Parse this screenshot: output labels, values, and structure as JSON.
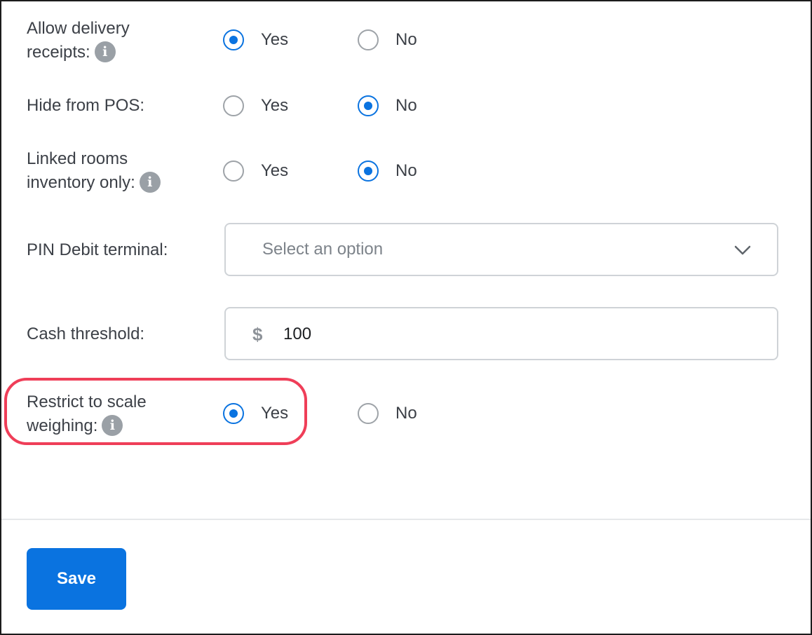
{
  "settings": {
    "delivery_receipts": {
      "label_line1": "Allow delivery",
      "label_line2": "receipts:",
      "info_icon": "i",
      "yes_label": "Yes",
      "no_label": "No",
      "selected": "Yes"
    },
    "hide_from_pos": {
      "label": "Hide from POS:",
      "yes_label": "Yes",
      "no_label": "No",
      "selected": "No"
    },
    "linked_rooms": {
      "label_line1": "Linked rooms",
      "label_line2": "inventory only:",
      "info_icon": "i",
      "yes_label": "Yes",
      "no_label": "No",
      "selected": "No"
    },
    "pin_debit": {
      "label": "PIN Debit terminal:",
      "placeholder": "Select an option"
    },
    "cash_threshold": {
      "label": "Cash threshold:",
      "currency_symbol": "$",
      "value": "100"
    },
    "scale_weighing": {
      "label_line1": "Restrict to scale",
      "label_line2": "weighing:",
      "info_icon": "i",
      "yes_label": "Yes",
      "no_label": "No",
      "selected": "Yes"
    }
  },
  "footer": {
    "save_label": "Save"
  },
  "colors": {
    "accent": "#0a73e0",
    "highlight": "#ef3e58"
  }
}
